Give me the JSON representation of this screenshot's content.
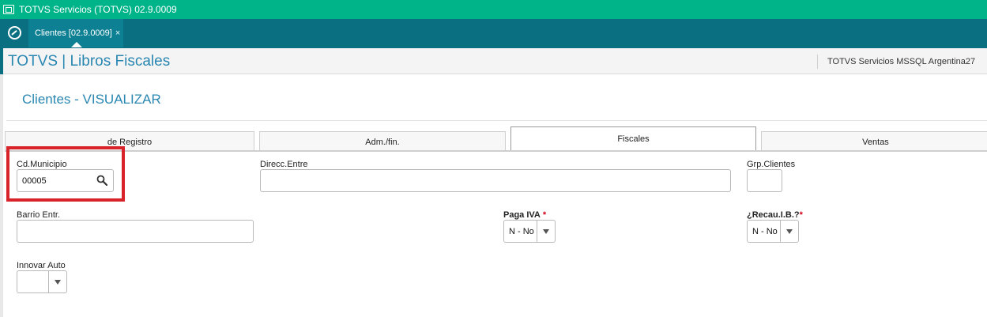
{
  "window": {
    "title": "TOTVS Servicios (TOTVS) 02.9.0009"
  },
  "tabbar": {
    "tab_label": "Clientes [02.9.0009]",
    "tab_close": "×"
  },
  "header": {
    "brand": "TOTVS | Libros Fiscales",
    "environment": "TOTVS Servicios MSSQL Argentina27"
  },
  "page": {
    "title": "Clientes - VISUALIZAR"
  },
  "folders": [
    {
      "label": "de Registro"
    },
    {
      "label": "Adm./fin."
    },
    {
      "label": "Fiscales"
    },
    {
      "label": "Ventas"
    }
  ],
  "fields": {
    "cd_municipio": {
      "label": "Cd.Municipio",
      "value": "00005"
    },
    "direcc_entre": {
      "label": "Direcc.Entre",
      "value": ""
    },
    "grp_clientes": {
      "label": "Grp.Clientes",
      "value": ""
    },
    "barrio_entr": {
      "label": "Barrio Entr.",
      "value": ""
    },
    "paga_iva": {
      "label": "Paga IVA",
      "required": "*",
      "value": "N - No"
    },
    "recau_ib": {
      "label": "¿Recau.I.B.?",
      "required": "*",
      "value": "N - No"
    },
    "innovar_auto": {
      "label": "Innovar Auto",
      "value": ""
    }
  },
  "colors": {
    "titlebar": "#00b48a",
    "tabbar": "#0a6f80",
    "brand": "#2a87b2",
    "highlight": "#d9232b"
  }
}
